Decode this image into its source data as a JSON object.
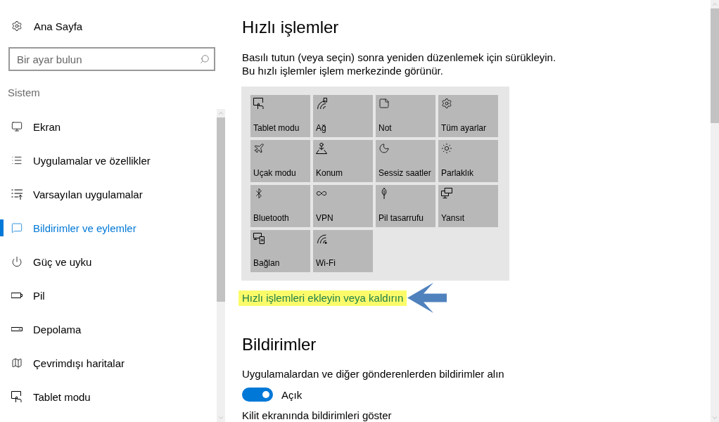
{
  "sidebar": {
    "home": {
      "label": "Ana Sayfa"
    },
    "search": {
      "placeholder": "Bir ayar bulun"
    },
    "section_label": "Sistem",
    "items": [
      {
        "label": "Ekran",
        "selected": false
      },
      {
        "label": "Uygulamalar ve özellikler",
        "selected": false
      },
      {
        "label": "Varsayılan uygulamalar",
        "selected": false
      },
      {
        "label": "Bildirimler ve eylemler",
        "selected": true
      },
      {
        "label": "Güç ve uyku",
        "selected": false
      },
      {
        "label": "Pil",
        "selected": false
      },
      {
        "label": "Depolama",
        "selected": false
      },
      {
        "label": "Çevrimdışı haritalar",
        "selected": false
      },
      {
        "label": "Tablet modu",
        "selected": false
      }
    ]
  },
  "quick_actions": {
    "title": "Hızlı işlemler",
    "description": [
      "Basılı tutun (veya seçin) sonra yeniden düzenlemek için sürükleyin.",
      "Bu hızlı işlemler işlem merkezinde görünür."
    ],
    "tiles": [
      {
        "label": "Tablet modu"
      },
      {
        "label": "Ağ"
      },
      {
        "label": "Not"
      },
      {
        "label": "Tüm ayarlar"
      },
      {
        "label": "Uçak modu"
      },
      {
        "label": "Konum"
      },
      {
        "label": "Sessiz saatler"
      },
      {
        "label": "Parlaklık"
      },
      {
        "label": "Bluetooth"
      },
      {
        "label": "VPN"
      },
      {
        "label": "Pil tasarrufu"
      },
      {
        "label": "Yansıt"
      },
      {
        "label": "Bağlan"
      },
      {
        "label": "Wi-Fi"
      }
    ],
    "link": {
      "label": "Hızlı işlemleri ekleyin veya kaldırın",
      "highlighted": true
    }
  },
  "notifications": {
    "title": "Bildirimler",
    "settings": [
      {
        "kind": "toggle",
        "label": "Uygulamalardan ve diğer gönderenlerden bildirimler alın",
        "on": true,
        "state_label": "Açık"
      },
      {
        "kind": "text",
        "label": "Kilit ekranında bildirimleri göster"
      }
    ]
  }
}
